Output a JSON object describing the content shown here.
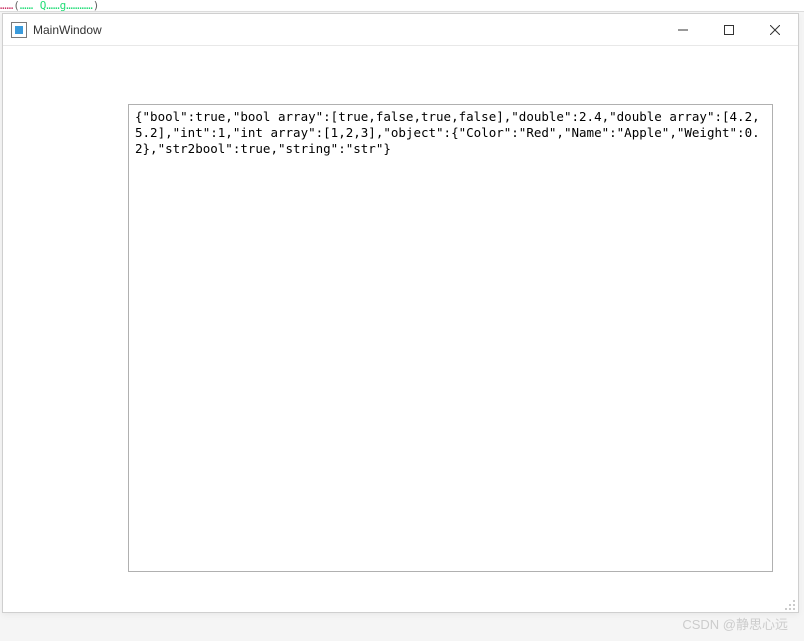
{
  "top_code_snippet": "……(…… Q……g…………)",
  "window": {
    "title": "MainWindow",
    "buttons": {
      "minimize": "minimize",
      "maximize": "maximize",
      "close": "close"
    }
  },
  "text_content": "{\"bool\":true,\"bool array\":[true,false,true,false],\"double\":2.4,\"double array\":[4.2,5.2],\"int\":1,\"int array\":[1,2,3],\"object\":{\"Color\":\"Red\",\"Name\":\"Apple\",\"Weight\":0.2},\"str2bool\":true,\"string\":\"str\"}",
  "watermark": "CSDN @静思心远"
}
